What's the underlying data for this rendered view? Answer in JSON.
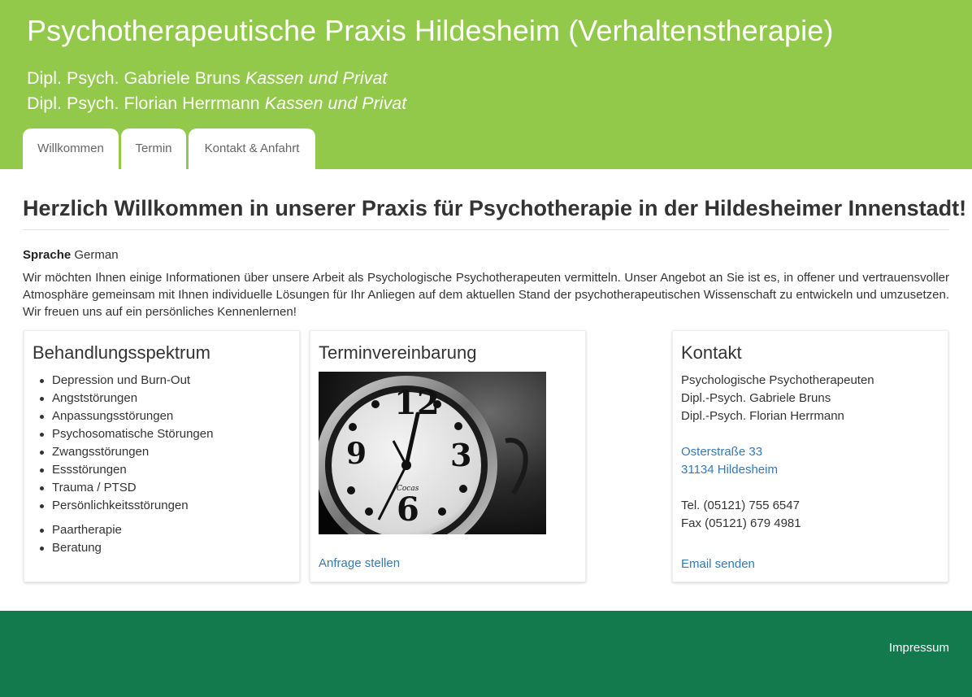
{
  "header": {
    "title": "Psychotherapeutische Praxis Hildesheim (Verhaltenstherapie)",
    "therapists": [
      {
        "name": "Dipl. Psych. Gabriele Bruns",
        "note": "Kassen und Privat"
      },
      {
        "name": "Dipl. Psych. Florian Herrmann",
        "note": "Kassen und Privat"
      }
    ],
    "tabs": [
      {
        "label": "Willkommen"
      },
      {
        "label": "Termin"
      },
      {
        "label": "Kontakt & Anfahrt"
      }
    ]
  },
  "main": {
    "heading": "Herzlich Willkommen in unserer Praxis für Psychotherapie in der Hildesheimer Innenstadt!",
    "language_label": "Sprache",
    "language_value": "German",
    "intro": "Wir möchten Ihnen einige Informationen über unsere Arbeit als Psychologische Psychotherapeuten vermitteln. Unser Angebot an Sie ist es, in offener und vertrauensvoller Atmosphäre gemeinsam mit Ihnen individuelle Lösungen für Ihr Anliegen auf dem aktuellen Stand der psychotherapeutischen Wissenschaft zu entwickeln und umzusetzen. Wir freuen uns auf ein persönliches Kennenlernen!"
  },
  "cards": {
    "spectrum": {
      "title": "Behandlungsspektrum",
      "items": [
        "Depression und Burn-Out",
        "Angststörungen",
        "Anpassungsstörungen",
        "Psychosomatische Störungen",
        "Zwangsstörungen",
        "Essstörungen",
        "Trauma / PTSD",
        "Persönlichkeitsstörungen"
      ],
      "items2": [
        "Paartherapie",
        "Beratung"
      ]
    },
    "appointment": {
      "title": "Terminvereinbarung",
      "clock_brand": "Cocas",
      "link": "Anfrage stellen"
    },
    "contact": {
      "title": "Kontakt",
      "line1": "Psychologische Psychotherapeuten",
      "line2": "Dipl.-Psych. Gabriele Bruns",
      "line3": "Dipl.-Psych. Florian Herrmann",
      "street": "Osterstraße 33",
      "city": "31134 Hildesheim",
      "tel": "Tel. (05121) 755 6547",
      "fax": "Fax (05121) 679 4981",
      "email_link": "Email senden"
    }
  },
  "footer": {
    "impressum": "Impressum"
  },
  "colors": {
    "header_green": "#92c94a",
    "footer_green": "#127a4c",
    "link_blue": "#337ab7"
  }
}
